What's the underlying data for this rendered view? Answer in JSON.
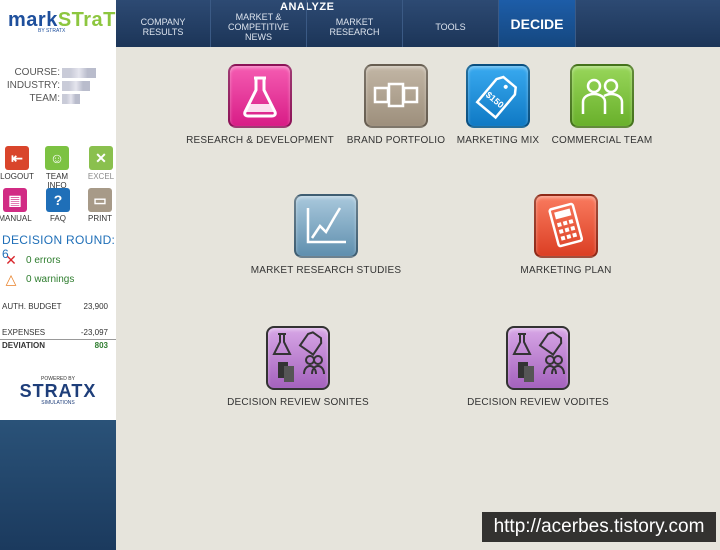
{
  "logo": {
    "name_part1": "mark",
    "name_part2": "STraT",
    "sub": "BY STRATX"
  },
  "course": {
    "course_label": "COURSE:",
    "industry_label": "INDUSTRY:",
    "team_label": "TEAM:"
  },
  "tools": [
    {
      "label": "LOGOUT",
      "glyph": "⇤",
      "color": "#d9452b"
    },
    {
      "label": "TEAM INFO",
      "glyph": "☺",
      "color": "#7cc242"
    },
    {
      "label": "EXCEL",
      "glyph": "✕",
      "color": "#8ac04e"
    },
    {
      "label": "MANUAL",
      "glyph": "▤",
      "color": "#d12b84"
    },
    {
      "label": "FAQ",
      "glyph": "?",
      "color": "#1f6fb8"
    },
    {
      "label": "PRINT",
      "glyph": "▭",
      "color": "#a79a88"
    }
  ],
  "decision": {
    "round_label": "DECISION ROUND: 6",
    "errors": "0 errors",
    "warnings": "0 warnings"
  },
  "budget": {
    "auth_label": "AUTH. BUDGET",
    "auth_value": "23,900",
    "expenses_label": "EXPENSES",
    "expenses_value": "-23,097",
    "deviation_label": "DEVIATION",
    "deviation_value": "803"
  },
  "stratx": {
    "powered": "POWERED BY",
    "name": "STRATX",
    "sub": "SIMULATIONS"
  },
  "nav": {
    "analyze": "ANALYZE",
    "company_results": "COMPANY RESULTS",
    "market_news": "MARKET & COMPETITIVE NEWS",
    "market_research": "MARKET RESEARCH",
    "tools": "TOOLS",
    "decide": "DECIDE"
  },
  "tiles": {
    "rd": "RESEARCH & DEVELOPMENT",
    "brand": "BRAND PORTFOLIO",
    "mix": "MARKETING MIX",
    "team": "COMMERCIAL TEAM",
    "studies": "MARKET RESEARCH STUDIES",
    "plan": "MARKETING PLAN",
    "sonites": "DECISION REVIEW SONITES",
    "vodites": "DECISION REVIEW VODITES"
  },
  "price_tag": "$150",
  "watermark": "http://acerbes.tistory.com",
  "colors": {
    "rd": "#e8319a",
    "brand": "#a89a88",
    "mix": "#1b8fd6",
    "team": "#7cc242",
    "studies": "#6e9bb8",
    "plan": "#e8553a",
    "review": "#b57bc9"
  }
}
